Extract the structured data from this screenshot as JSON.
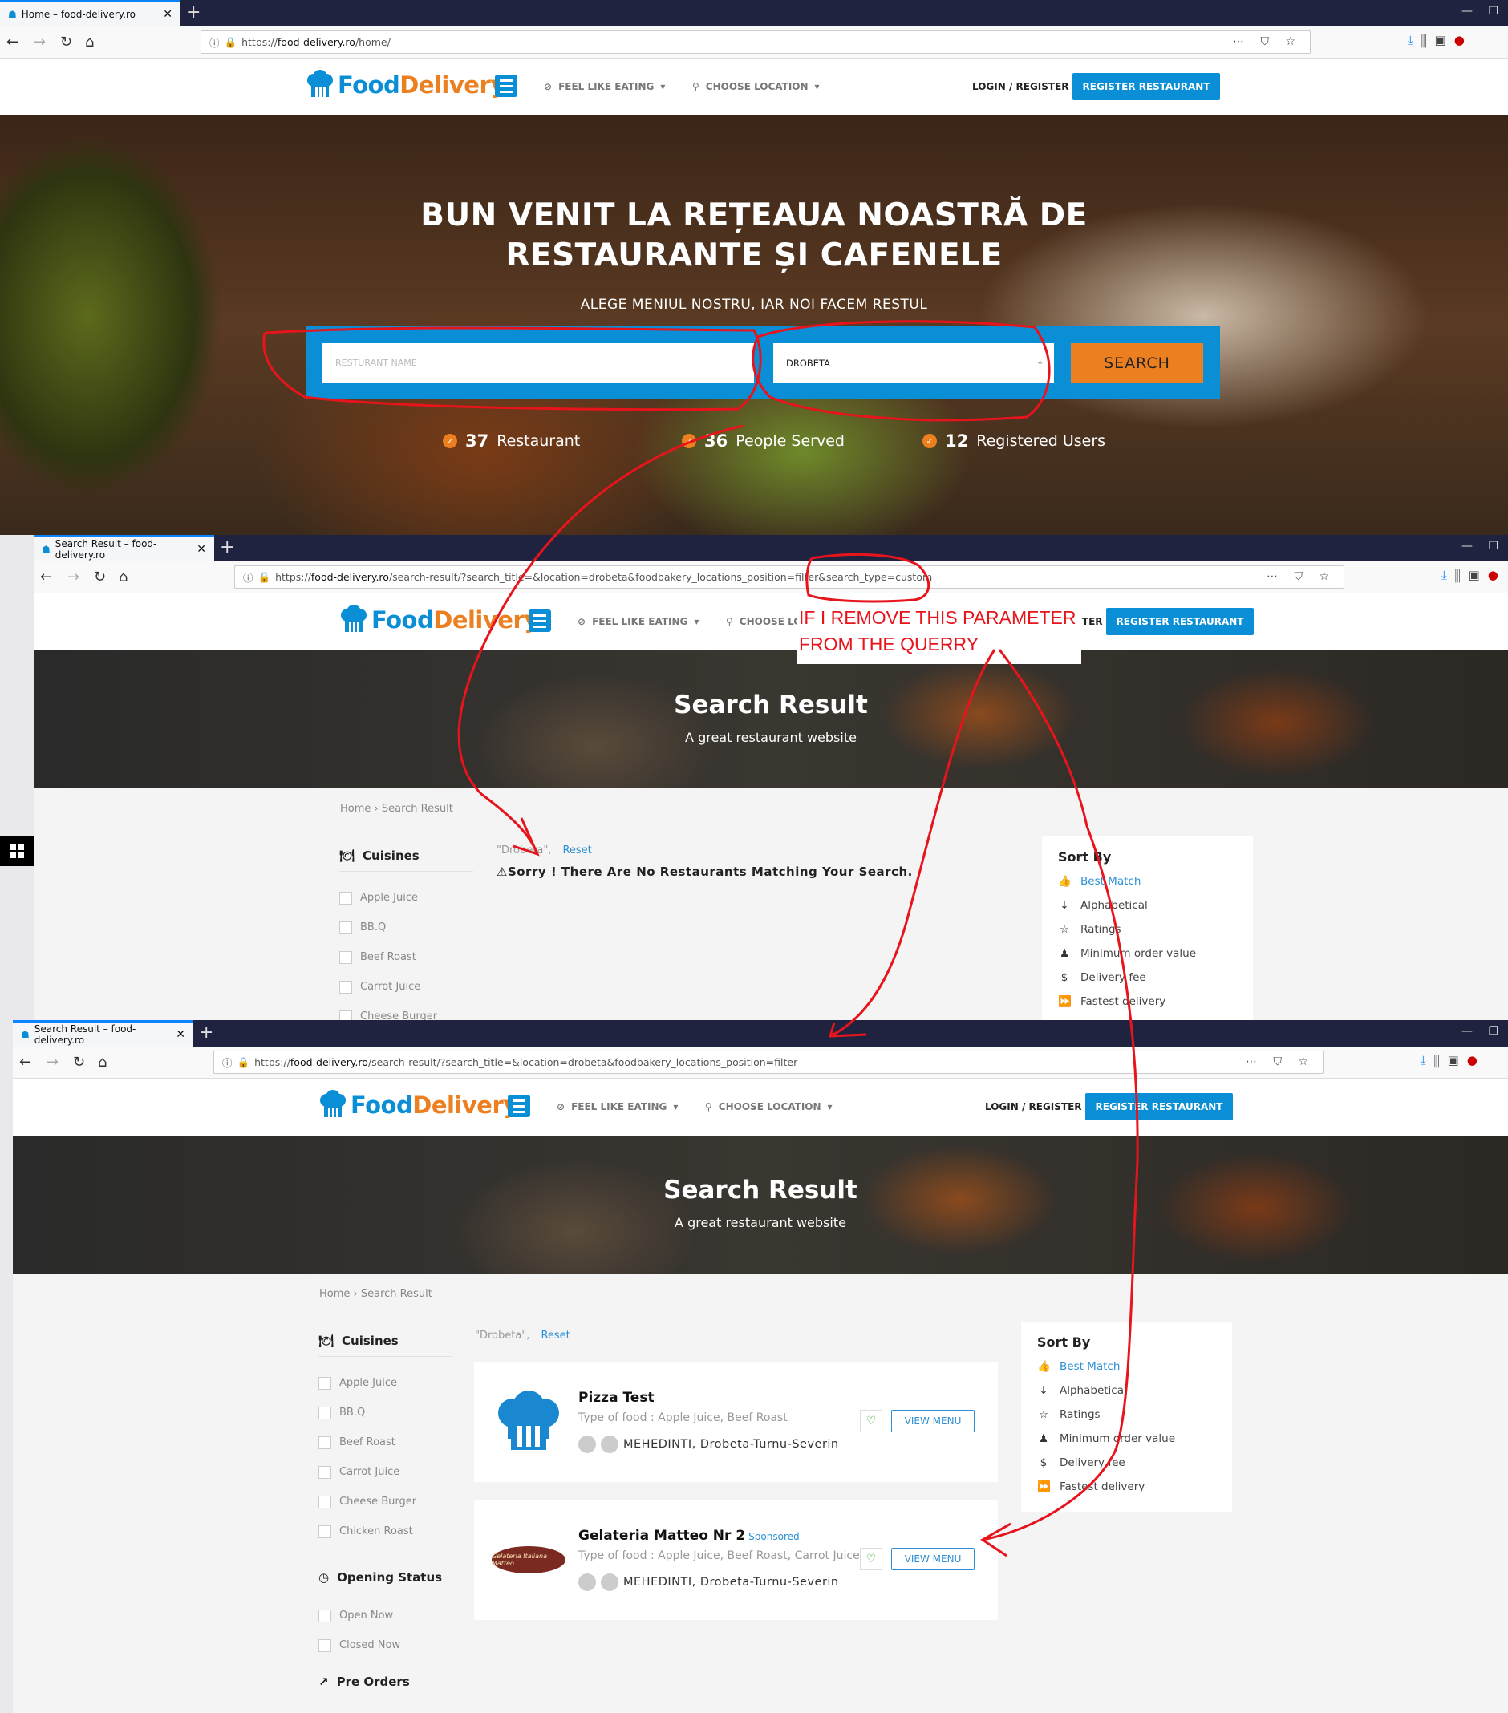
{
  "site": {
    "logo_food": "Food",
    "logo_delivery": "Delivery",
    "feel_like_eating": "FEEL LIKE EATING",
    "choose_location": "CHOOSE LOCATION",
    "login_register": "LOGIN / REGISTER",
    "register_restaurant": "REGISTER RESTAURANT"
  },
  "windows": [
    {
      "tab_title": "Home – food-delivery.ro",
      "url_scheme": "https://",
      "url_domain": "food-delivery.ro",
      "url_path": "/home/"
    },
    {
      "tab_title": "Search Result – food-delivery.ro",
      "url_scheme": "https://",
      "url_domain": "food-delivery.ro",
      "url_path": "/search-result/?search_title=&location=drobeta&foodbakery_locations_position=filter&search_type=custom"
    },
    {
      "tab_title": "Search Result – food-delivery.ro",
      "url_scheme": "https://",
      "url_domain": "food-delivery.ro",
      "url_path": "/search-result/?search_title=&location=drobeta&foodbakery_locations_position=filter"
    }
  ],
  "home": {
    "heading_line1": "BUN VENIT LA REȚEAUA NOASTRĂ DE",
    "heading_line2": "RESTAURANTE ȘI CAFENELE",
    "subheading": "ALEGE MENIUL NOSTRU, IAR NOI FACEM RESTUL",
    "restaurant_placeholder": "RESTURANT NAME",
    "location_value": "DROBETA",
    "search_label": "SEARCH",
    "stats": [
      {
        "value": "37",
        "label": "Restaurant"
      },
      {
        "value": "36",
        "label": "People Served"
      },
      {
        "value": "12",
        "label": "Registered Users"
      }
    ]
  },
  "search": {
    "title": "Search Result",
    "subtitle": "A great restaurant website",
    "breadcrumb": [
      "Home",
      "›",
      "Search Result"
    ],
    "filter_tag": "\"Drobeta\",",
    "reset": "Reset",
    "no_results": "Sorry !  There Are No Restaurants Matching Your Search.",
    "cuisines_heading": "Cuisines",
    "cuisines": [
      "Apple Juice",
      "BB.Q",
      "Beef Roast",
      "Carrot Juice",
      "Cheese Burger",
      "Chicken Roast"
    ],
    "opening_status_heading": "Opening Status",
    "opening_status": [
      "Open Now",
      "Closed Now"
    ],
    "pre_orders_heading": "Pre Orders",
    "sort_heading": "Sort By",
    "sort_options": [
      "Best Match",
      "Alphabetical",
      "Ratings",
      "Minimum order value",
      "Delivery fee",
      "Fastest delivery"
    ],
    "results": [
      {
        "name": "Pizza Test",
        "sponsored": "",
        "type": "Type of food : Apple Juice, Beef Roast",
        "location": "MEHEDINTI, Drobeta-Turnu-Severin",
        "view_menu": "VIEW MENU"
      },
      {
        "name": "Gelateria Matteo Nr 2",
        "sponsored": "Sponsored",
        "type": "Type of food : Apple Juice, Beef Roast, Carrot Juice",
        "location": "MEHEDINTI, Drobeta-Turnu-Severin",
        "view_menu": "VIEW MENU",
        "logo_text": "Gelateria Italiana Matteo"
      }
    ]
  },
  "annotation": {
    "line1": "IF I REMOVE THIS PARAMETER",
    "line2": "FROM THE QUERRY",
    "color": "#e8141c"
  }
}
